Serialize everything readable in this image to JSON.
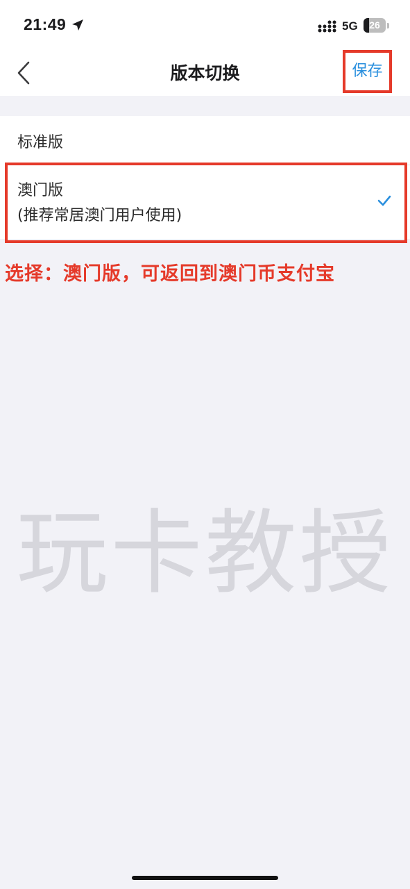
{
  "status_bar": {
    "time": "21:49",
    "network": "5G",
    "battery": "26",
    "battery_level_percent": 26,
    "location_icon": "location-arrow-icon",
    "signal_icon": "cellular-signal-icon"
  },
  "nav": {
    "title": "版本切换",
    "save_label": "保存",
    "back_icon": "chevron-left-icon"
  },
  "options": {
    "standard": "标准版",
    "macau": "澳门版",
    "macau_note": "(推荐常居澳门用户使用)",
    "selected_icon": "checkmark-icon"
  },
  "annotation": "选择：澳门版，可返回到澳门币支付宝",
  "watermark": "玩卡教授",
  "colors": {
    "accent": "#2a8fde",
    "highlight": "#e53a2a",
    "background": "#f2f2f7"
  }
}
